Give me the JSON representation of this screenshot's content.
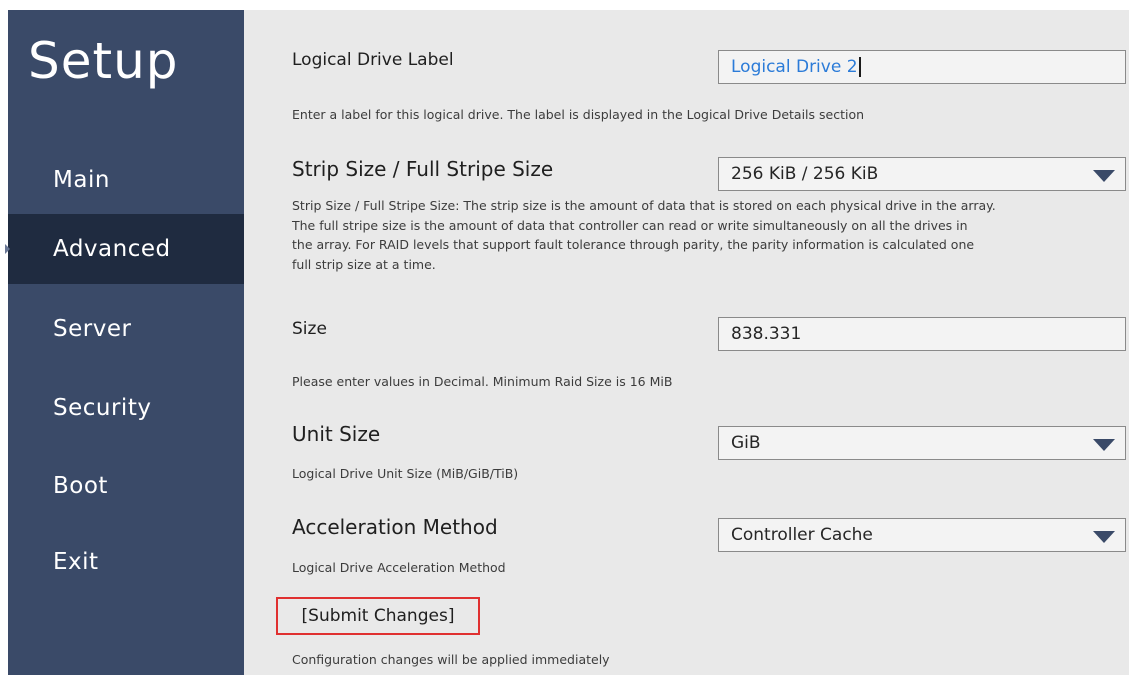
{
  "sidebar": {
    "title": "Setup",
    "items": [
      {
        "label": "Main"
      },
      {
        "label": "Advanced"
      },
      {
        "label": "Server"
      },
      {
        "label": "Security"
      },
      {
        "label": "Boot"
      },
      {
        "label": "Exit"
      }
    ],
    "active": "Advanced"
  },
  "form": {
    "logical_drive_label": {
      "label": "Logical Drive Label",
      "value": "Logical Drive 2",
      "help": "Enter a label for this logical drive. The label is displayed in the Logical Drive Details section"
    },
    "strip_size": {
      "label": "Strip Size / Full Stripe Size",
      "value": "256 KiB / 256 KiB",
      "help": [
        "Strip Size / Full Stripe Size: The strip size is the amount of data that is stored on each physical drive in the array.",
        "The full stripe size is the amount of data that controller can read or write simultaneously on all the drives in",
        "the array. For RAID levels that support fault tolerance through parity, the parity information is calculated one",
        "full strip size at a time."
      ]
    },
    "size": {
      "label": "Size",
      "value": "838.331",
      "help": "Please enter values in Decimal. Minimum Raid Size is 16 MiB"
    },
    "unit_size": {
      "label": "Unit Size",
      "value": "GiB",
      "help": "Logical Drive Unit Size (MiB/GiB/TiB)"
    },
    "acceleration_method": {
      "label": "Acceleration Method",
      "value": "Controller Cache",
      "help": "Logical Drive Acceleration Method"
    },
    "submit": {
      "label": "[Submit Changes]",
      "help": "Configuration changes will be applied immediately"
    }
  },
  "colors": {
    "sidebar_bg": "#3a4a68",
    "sidebar_active_bg": "#1f2b40",
    "content_bg": "#e9e9e9",
    "text_input_value": "#2b7bd8",
    "highlight_border": "#e03030"
  },
  "icons": {
    "dropdown": "triangle-down-icon",
    "active_nav": "pointer-icon"
  }
}
